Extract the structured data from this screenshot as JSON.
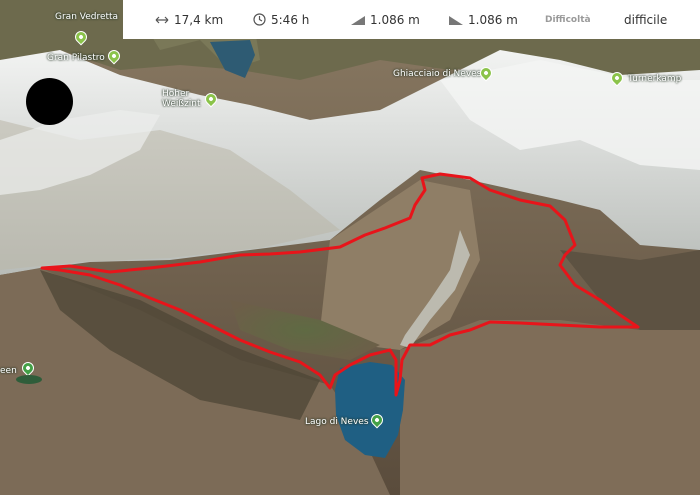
{
  "stats": {
    "distance": "17,4 km",
    "duration": "5:46 h",
    "ascent": "1.086 m",
    "descent": "1.086 m",
    "difficulty_label": "Difficoltà",
    "difficulty_value": "difficile"
  },
  "pois": [
    {
      "name": "Gran Vedretta"
    },
    {
      "name": "Gran Pilastro"
    },
    {
      "name": "Hoher Weißzint"
    },
    {
      "name": "Ghiacciaio di Neves"
    },
    {
      "name": "Turnerkamp"
    },
    {
      "name": "Lago di Neves"
    },
    {
      "name": "een"
    }
  ],
  "icons": {
    "distance": "horizontal-arrows-icon",
    "duration": "clock-icon",
    "ascent": "ascent-icon",
    "descent": "descent-icon",
    "peak": "mountain-pin-icon",
    "lake": "lake-pin-icon"
  },
  "colors": {
    "route": "#e8141a",
    "peak_pin": "#8bc34a",
    "lake_pin": "#43a047",
    "lake_water": "#1f5f83"
  }
}
